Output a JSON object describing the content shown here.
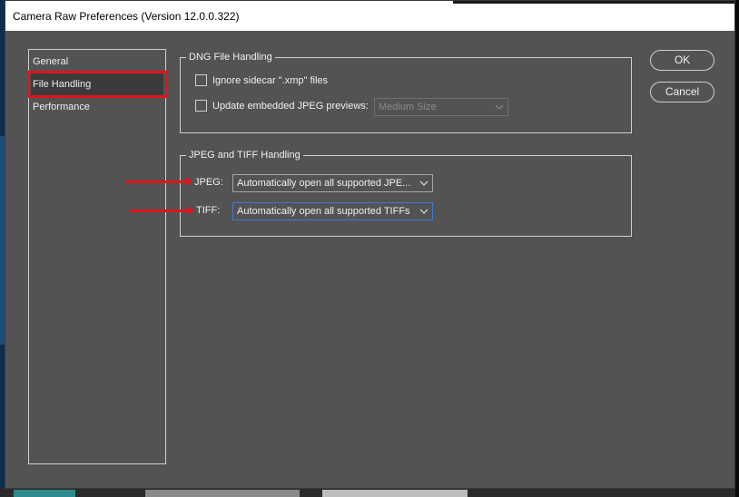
{
  "window": {
    "title": "Camera Raw Preferences  (Version 12.0.0.322)"
  },
  "sidebar": {
    "items": [
      {
        "label": "General"
      },
      {
        "label": "File Handling"
      },
      {
        "label": "Performance"
      }
    ],
    "selected": "File Handling"
  },
  "dng_group": {
    "title": "DNG File Handling",
    "ignore_sidecar_label": "Ignore sidecar \".xmp\" files",
    "ignore_sidecar_checked": false,
    "update_previews_label": "Update embedded JPEG previews:",
    "update_previews_checked": false,
    "preview_size_value": "Medium Size"
  },
  "jpeg_tiff_group": {
    "title": "JPEG and TIFF Handling",
    "jpeg_label": "JPEG:",
    "jpeg_value": "Automatically open all supported JPE...",
    "tiff_label": "TIFF:",
    "tiff_value": "Automatically open all supported TIFFs"
  },
  "buttons": {
    "ok": "OK",
    "cancel": "Cancel"
  },
  "colors": {
    "dialog_bg": "#535353",
    "annotation_red": "#e0141b",
    "focus_blue": "#3d7bd4"
  },
  "icons": [
    "chevron-down-icon",
    "arrow-right-annotation"
  ]
}
